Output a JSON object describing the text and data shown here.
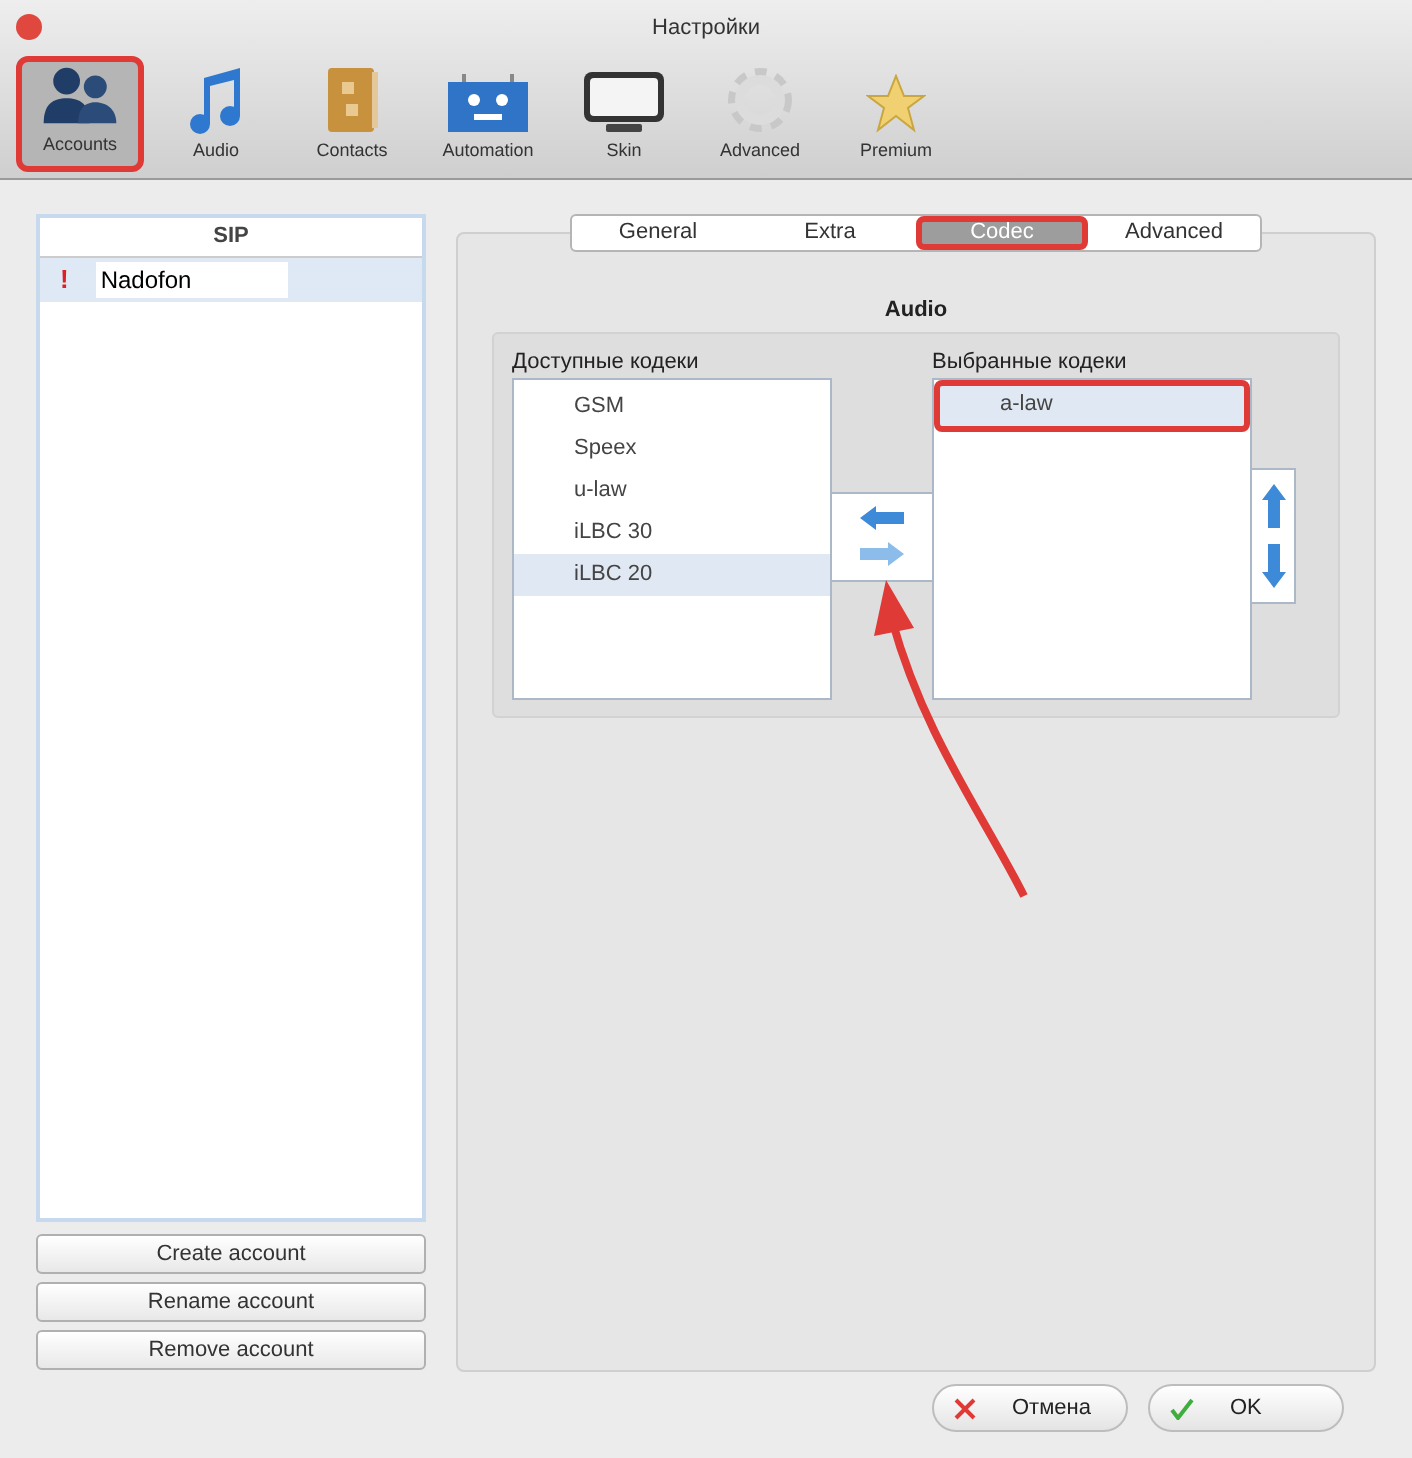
{
  "window": {
    "title": "Настройки"
  },
  "toolbar": [
    {
      "label": "Accounts",
      "kind": "accounts",
      "selected": true,
      "highlighted": true
    },
    {
      "label": "Audio",
      "kind": "audio",
      "selected": false,
      "highlighted": false
    },
    {
      "label": "Contacts",
      "kind": "contacts",
      "selected": false,
      "highlighted": false
    },
    {
      "label": "Automation",
      "kind": "automation",
      "selected": false,
      "highlighted": false
    },
    {
      "label": "Skin",
      "kind": "skin",
      "selected": false,
      "highlighted": false
    },
    {
      "label": "Advanced",
      "kind": "advanced",
      "selected": false,
      "highlighted": false
    },
    {
      "label": "Premium",
      "kind": "premium",
      "selected": false,
      "highlighted": false
    }
  ],
  "accounts": {
    "header": "SIP",
    "items": [
      {
        "name": "Nadofon",
        "warning": "!",
        "selected": true
      }
    ]
  },
  "account_buttons": [
    "Create account",
    "Rename account",
    "Remove account"
  ],
  "tabs": [
    {
      "label": "General",
      "selected": false,
      "highlighted": false
    },
    {
      "label": "Extra",
      "selected": false,
      "highlighted": false
    },
    {
      "label": "Codec",
      "selected": true,
      "highlighted": true
    },
    {
      "label": "Advanced",
      "selected": false,
      "highlighted": false
    }
  ],
  "audio": {
    "title": "Audio",
    "available": {
      "label": "Доступные кодеки",
      "items": [
        {
          "name": "GSM",
          "selected": false
        },
        {
          "name": "Speex",
          "selected": false
        },
        {
          "name": "u-law",
          "selected": false
        },
        {
          "name": "iLBC 30",
          "selected": false
        },
        {
          "name": "iLBC 20",
          "selected": true
        }
      ]
    },
    "chosen": {
      "label": "Выбранные кодеки",
      "items": [
        {
          "name": "a-law",
          "selected": true,
          "highlighted": true
        }
      ]
    }
  },
  "dialog_buttons": [
    {
      "label": "Отмена",
      "kind": "cancel"
    },
    {
      "label": "OK",
      "kind": "ok"
    }
  ]
}
